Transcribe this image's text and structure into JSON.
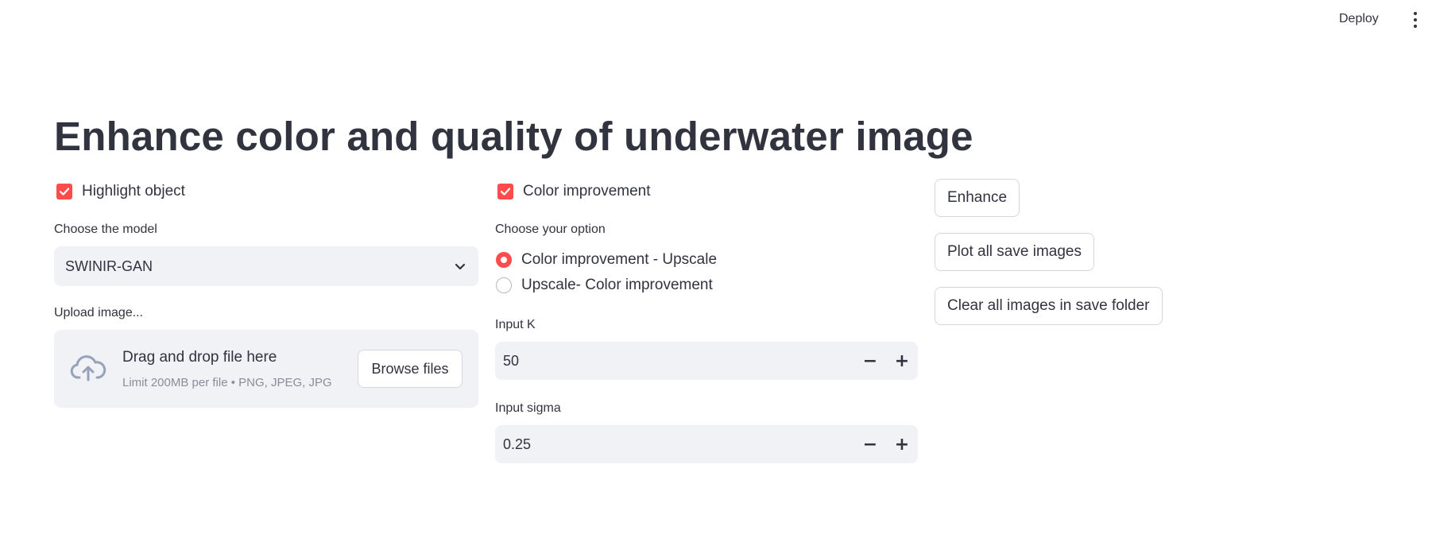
{
  "header": {
    "deploy_label": "Deploy",
    "menu_icon": "kebab-menu-icon"
  },
  "title": "Enhance color and quality of underwater image",
  "left_column": {
    "highlight_checkbox": {
      "label": "Highlight object",
      "checked": true
    },
    "model_select": {
      "label": "Choose the model",
      "value": "SWINIR-GAN"
    },
    "uploader": {
      "label": "Upload image...",
      "title": "Drag and drop file here",
      "limit": "Limit 200MB per file • PNG, JPEG, JPG",
      "button": "Browse files"
    }
  },
  "middle_column": {
    "color_checkbox": {
      "label": "Color improvement",
      "checked": true
    },
    "option_radio": {
      "label": "Choose your option",
      "options": [
        {
          "label": "Color improvement - Upscale",
          "selected": true
        },
        {
          "label": "Upscale- Color improvement",
          "selected": false
        }
      ]
    },
    "input_k": {
      "label": "Input K",
      "value": "50"
    },
    "input_sigma": {
      "label": "Input sigma",
      "value": "0.25"
    },
    "decrement_symbol": "−",
    "increment_symbol": "+"
  },
  "right_column": {
    "enhance_button": "Enhance",
    "plot_button": "Plot all save images",
    "clear_button": "Clear all images in save folder"
  },
  "colors": {
    "accent": "#ff4b4b",
    "text": "#31333f",
    "input_bg": "#f0f2f6"
  }
}
